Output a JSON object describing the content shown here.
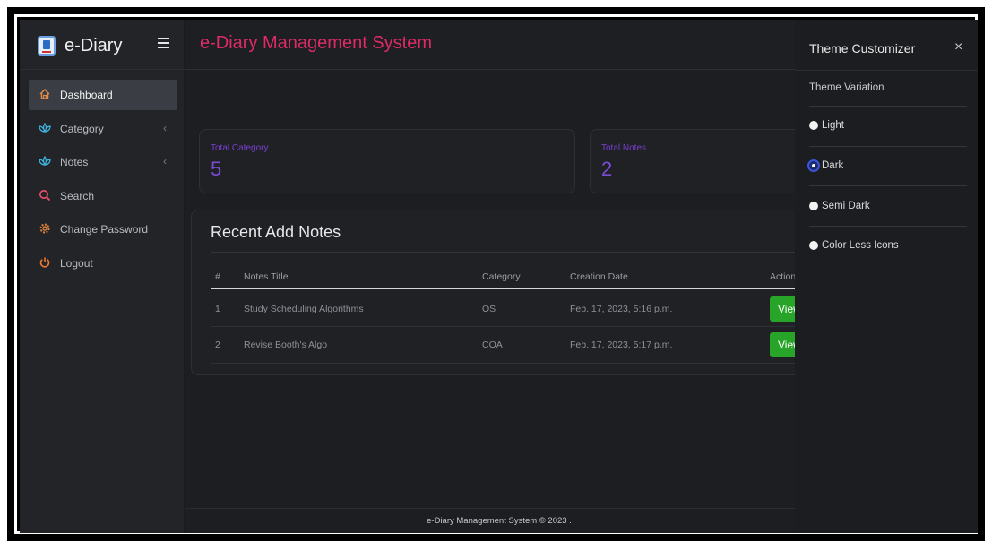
{
  "brand": {
    "name": "e-Diary"
  },
  "header": {
    "title": "e-Diary Management System"
  },
  "sidebar": {
    "items": [
      {
        "label": "Dashboard",
        "icon": "home-icon",
        "active": true
      },
      {
        "label": "Category",
        "icon": "lotus-icon",
        "has_submenu": true
      },
      {
        "label": "Notes",
        "icon": "lotus-icon",
        "has_submenu": true
      },
      {
        "label": "Search",
        "icon": "search-icon"
      },
      {
        "label": "Change Password",
        "icon": "gear-icon"
      },
      {
        "label": "Logout",
        "icon": "power-icon"
      }
    ]
  },
  "stats": [
    {
      "label": "Total Category",
      "value": "5"
    },
    {
      "label": "Total Notes",
      "value": "2"
    }
  ],
  "notes": {
    "title": "Recent Add Notes",
    "columns": [
      "#",
      "Notes Title",
      "Category",
      "Creation Date",
      "Action"
    ],
    "rows": [
      {
        "num": "1",
        "title": "Study Scheduling Algorithms",
        "category": "OS",
        "date": "Feb. 17, 2023, 5:16 p.m.",
        "action": "View"
      },
      {
        "num": "2",
        "title": "Revise Booth's Algo",
        "category": "COA",
        "date": "Feb. 17, 2023, 5:17 p.m.",
        "action": "View"
      }
    ]
  },
  "footer": {
    "text": "e-Diary Management System © 2023 ."
  },
  "customizer": {
    "title": "Theme Customizer",
    "close": "×",
    "section": "Theme Variation",
    "options": [
      {
        "label": "Light",
        "checked": false
      },
      {
        "label": "Dark",
        "checked": true
      },
      {
        "label": "Semi Dark",
        "checked": false
      },
      {
        "label": "Color Less Icons",
        "checked": false
      }
    ]
  },
  "colors": {
    "accent_title": "#e02a66",
    "stat_purple": "#7a4bd6",
    "view_button": "#28a528",
    "background": "#1c1e22"
  }
}
